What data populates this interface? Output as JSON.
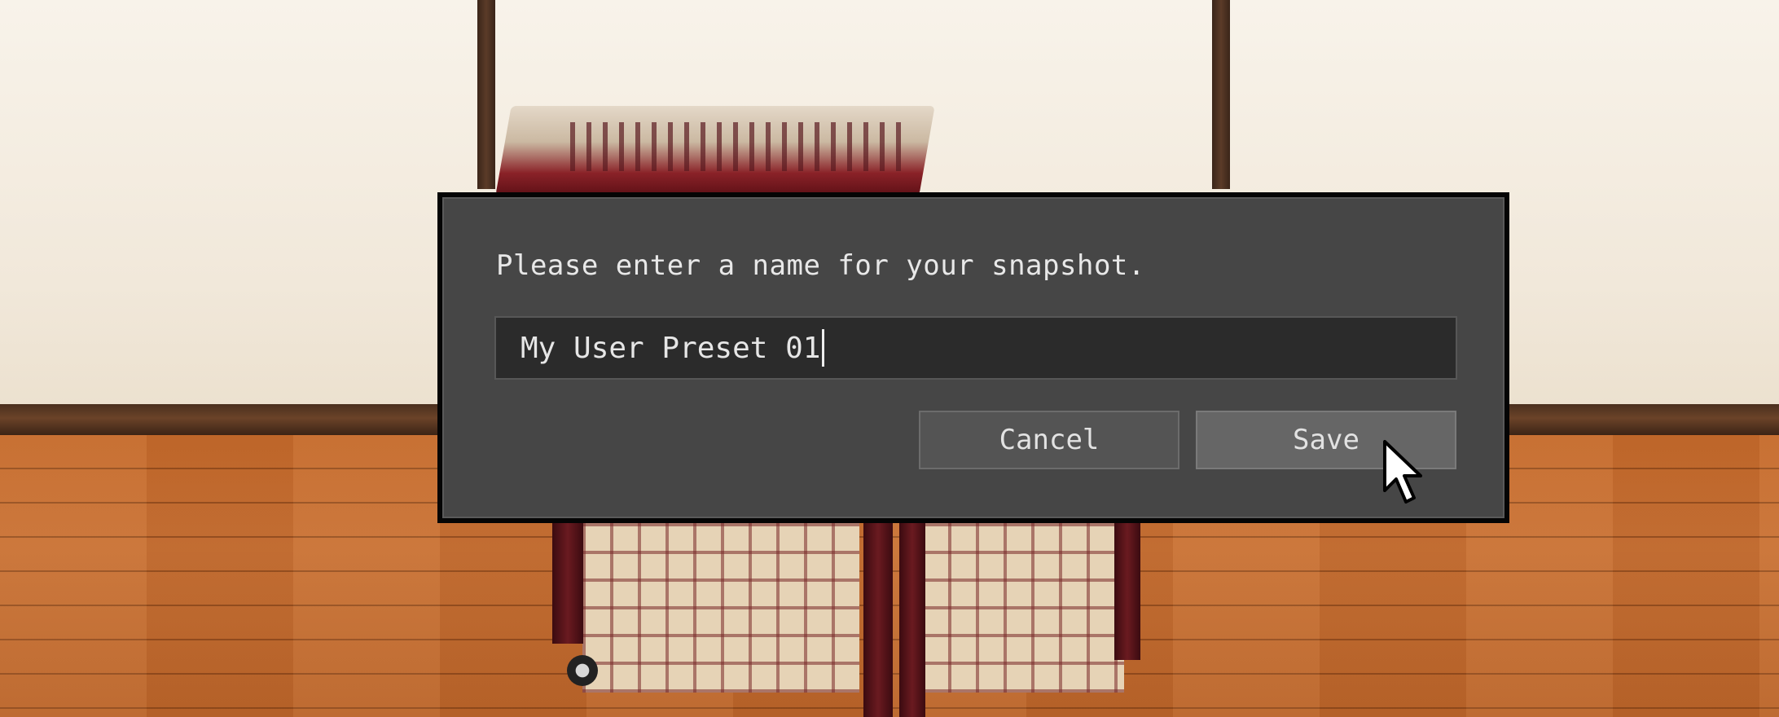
{
  "dialog": {
    "prompt": "Please enter a name for your snapshot.",
    "input_value": "My User Preset 01",
    "cancel_label": "Cancel",
    "save_label": "Save"
  },
  "icons": {
    "cursor": "arrow-pointer-icon"
  },
  "colors": {
    "dialog_background": "#464646",
    "dialog_border": "#050505",
    "input_background": "#2b2b2b",
    "button_cancel": "#545454",
    "button_save": "#666666",
    "text": "#e6e6e6"
  }
}
